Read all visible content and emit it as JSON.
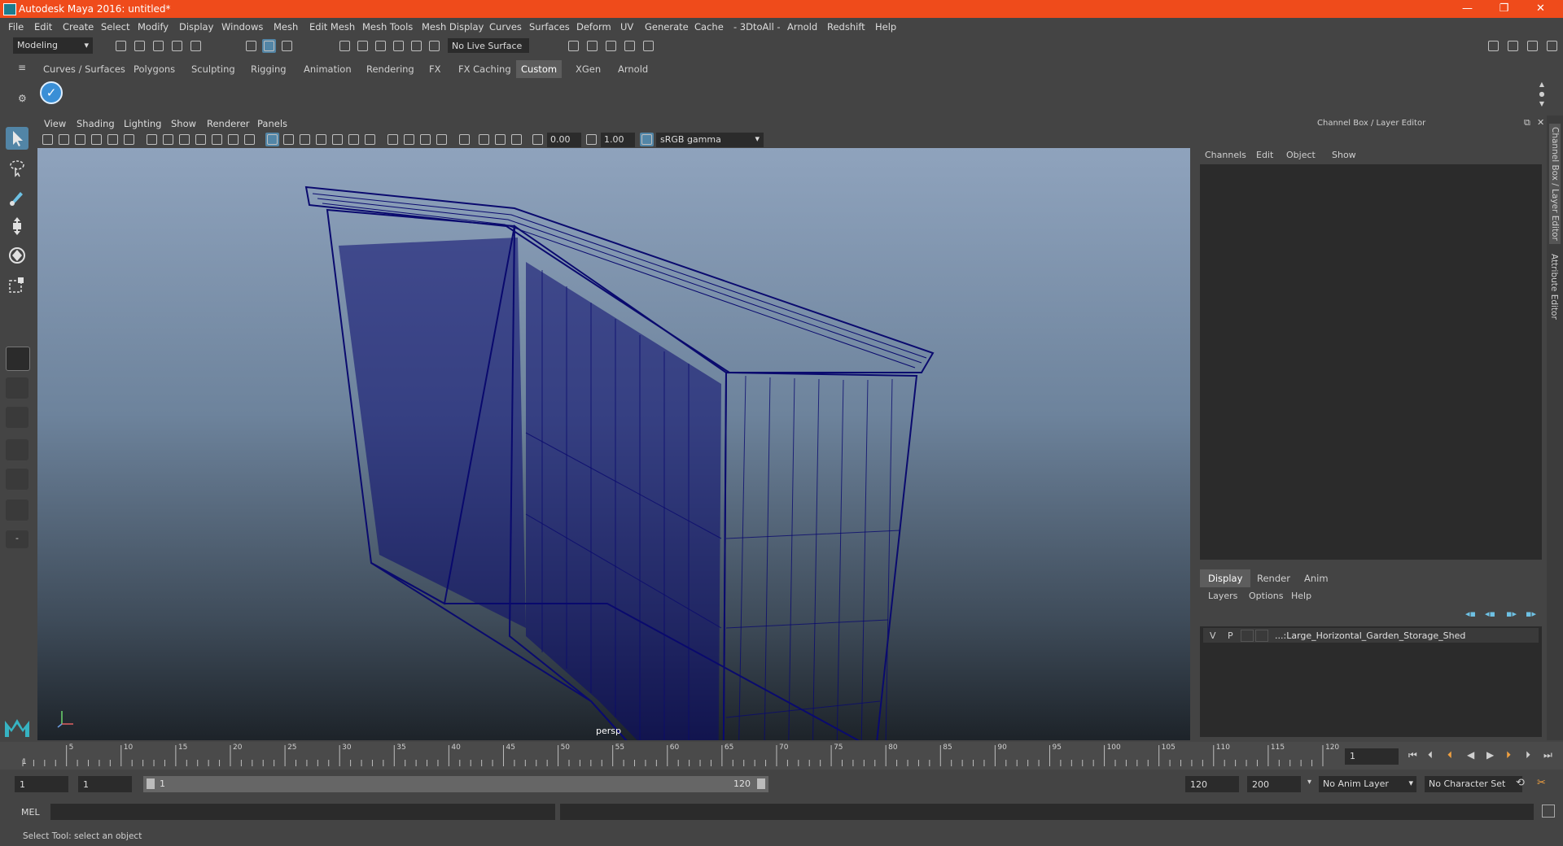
{
  "titlebar": {
    "title": "Autodesk Maya 2016: untitled*",
    "minimize": "—",
    "maximize": "❐",
    "close": "✕"
  },
  "menubar": {
    "items": [
      "File",
      "Edit",
      "Create",
      "Select",
      "Modify",
      "Display",
      "Windows",
      "Mesh",
      "Edit Mesh",
      "Mesh Tools",
      "Mesh Display",
      "Curves",
      "Surfaces",
      "Deform",
      "UV",
      "Generate",
      "Cache",
      "- 3DtoAll -",
      "Arnold",
      "Redshift",
      "Help"
    ]
  },
  "toolbar": {
    "mode": "Modeling",
    "live_surface": "No Live Surface"
  },
  "shelf": {
    "tabs": [
      "Curves / Surfaces",
      "Polygons",
      "Sculpting",
      "Rigging",
      "Animation",
      "Rendering",
      "FX",
      "FX Caching",
      "Custom",
      "XGen",
      "Arnold"
    ],
    "active_tab": "Custom"
  },
  "viewport": {
    "menu": [
      "View",
      "Shading",
      "Lighting",
      "Show",
      "Renderer",
      "Panels"
    ],
    "exposure": "0.00",
    "gamma": "1.00",
    "color_space": "sRGB gamma",
    "camera_label": "persp"
  },
  "channelbox": {
    "header": "Channel Box / Layer Editor",
    "menu": [
      "Channels",
      "Edit",
      "Object",
      "Show"
    ],
    "side_tabs": [
      "Channel Box / Layer Editor",
      "Attribute Editor"
    ]
  },
  "layer_editor": {
    "tabs": [
      "Display",
      "Render",
      "Anim"
    ],
    "active_tab": "Display",
    "menu": [
      "Layers",
      "Options",
      "Help"
    ],
    "layers": [
      {
        "v": "V",
        "p": "P",
        "name": "...:Large_Horizontal_Garden_Storage_Shed"
      }
    ]
  },
  "timeline": {
    "ticks": [
      "5",
      "10",
      "15",
      "20",
      "25",
      "30",
      "35",
      "40",
      "45",
      "50",
      "55",
      "60",
      "65",
      "70",
      "75",
      "80",
      "85",
      "90",
      "95",
      "100",
      "105",
      "110",
      "115",
      "120"
    ],
    "current_marker": "1",
    "current_frame": "1"
  },
  "range": {
    "start": "1",
    "playback_start": "1",
    "slider_start": "1",
    "slider_end": "120",
    "playback_end": "120",
    "end": "200",
    "anim_layer": "No Anim Layer",
    "character_set": "No Character Set"
  },
  "cmdline": {
    "label": "MEL"
  },
  "helpline": {
    "text": "Select Tool: select an object"
  },
  "colors": {
    "titlebar": "#ef4b1b",
    "viewport_top": "#8fa3bd",
    "viewport_bottom": "#1d2329",
    "wireframe": "#0a0a6e",
    "active_tab": "#5d5d5d"
  }
}
